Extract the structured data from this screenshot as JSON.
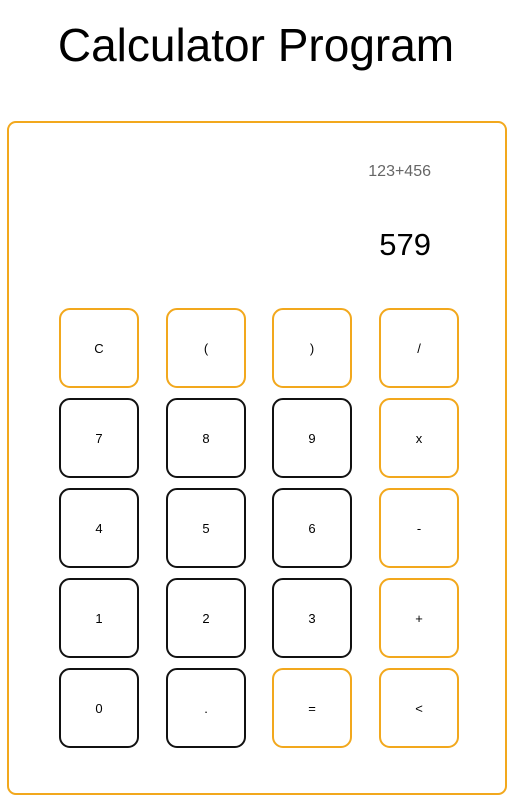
{
  "page": {
    "title": "Calculator Program"
  },
  "display": {
    "expression": "123+456",
    "result": "579"
  },
  "colors": {
    "accent": "#f2a81d",
    "key_border": "#111111",
    "expression_text": "#666666"
  },
  "keys": [
    {
      "label": "C",
      "accent": true,
      "name": "clear-button"
    },
    {
      "label": "(",
      "accent": true,
      "name": "open-paren-button"
    },
    {
      "label": ")",
      "accent": true,
      "name": "close-paren-button"
    },
    {
      "label": "/",
      "accent": true,
      "name": "divide-button"
    },
    {
      "label": "7",
      "accent": false,
      "name": "digit-7-button"
    },
    {
      "label": "8",
      "accent": false,
      "name": "digit-8-button"
    },
    {
      "label": "9",
      "accent": false,
      "name": "digit-9-button"
    },
    {
      "label": "x",
      "accent": true,
      "name": "multiply-button"
    },
    {
      "label": "4",
      "accent": false,
      "name": "digit-4-button"
    },
    {
      "label": "5",
      "accent": false,
      "name": "digit-5-button"
    },
    {
      "label": "6",
      "accent": false,
      "name": "digit-6-button"
    },
    {
      "label": "-",
      "accent": true,
      "name": "subtract-button"
    },
    {
      "label": "1",
      "accent": false,
      "name": "digit-1-button"
    },
    {
      "label": "2",
      "accent": false,
      "name": "digit-2-button"
    },
    {
      "label": "3",
      "accent": false,
      "name": "digit-3-button"
    },
    {
      "label": "+",
      "accent": true,
      "name": "add-button"
    },
    {
      "label": "0",
      "accent": false,
      "name": "digit-0-button"
    },
    {
      "label": ".",
      "accent": false,
      "name": "decimal-button"
    },
    {
      "label": "=",
      "accent": true,
      "name": "equals-button"
    },
    {
      "label": "<",
      "accent": true,
      "name": "backspace-button"
    }
  ]
}
